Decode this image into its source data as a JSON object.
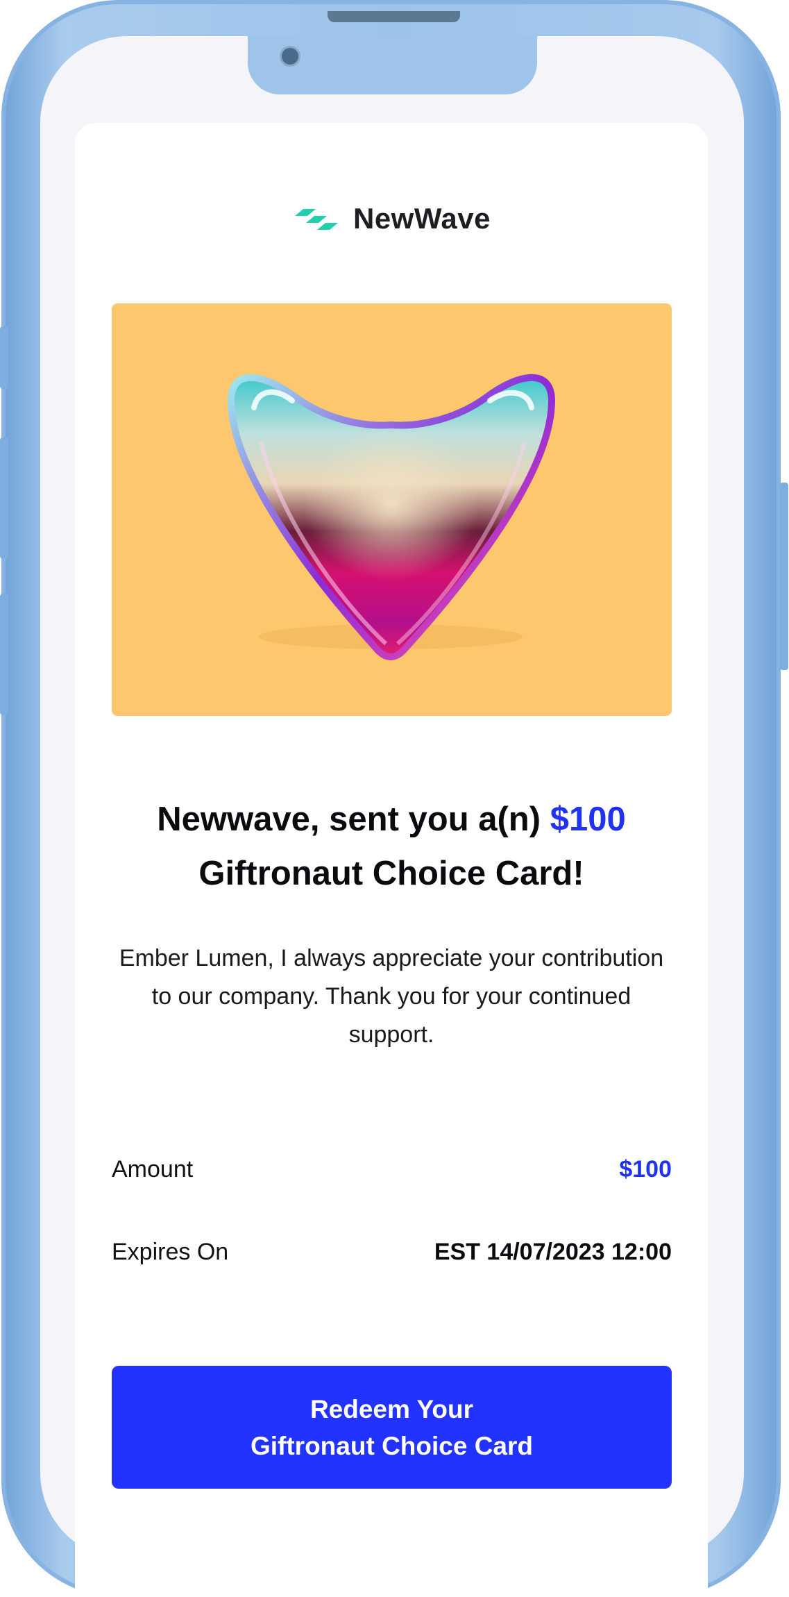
{
  "brand": {
    "name": "NewWave",
    "logo_icon": "newwave-logo-icon",
    "accent": "#1fcfae"
  },
  "hero": {
    "image": "glass-heart-illustration",
    "background": "#fdc76d"
  },
  "headline": {
    "prefix": "Newwave, sent you a(n)",
    "amount": "$100",
    "suffix": "Giftronaut Choice Card!"
  },
  "message": "Ember Lumen, I always appreciate your contribution to our company. Thank you for your continued support.",
  "details": {
    "amount_label": "Amount",
    "amount_value": "$100",
    "expires_label": "Expires On",
    "expires_value": "EST 14/07/2023 12:00"
  },
  "cta": {
    "line1": "Redeem Your",
    "line2": "Giftronaut Choice Card",
    "color": "#2233ff"
  },
  "colors": {
    "amount_blue": "#2233f0",
    "phone_frame": "#9cc3ea",
    "screen_bg": "#f4f4f9"
  }
}
